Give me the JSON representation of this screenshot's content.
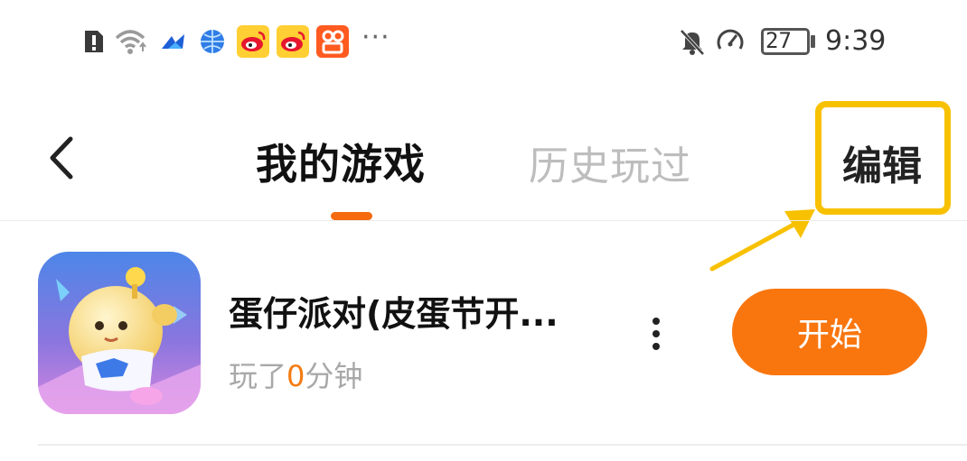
{
  "status_bar": {
    "time": "9:39",
    "battery_level": "27",
    "more_indicator": "···",
    "icons": [
      "alert-icon",
      "wifi-icon",
      "app-arrow-icon",
      "globe-icon",
      "weibo-icon",
      "weibo-icon",
      "video-app-icon",
      "mute-icon",
      "speed-icon",
      "battery-icon"
    ]
  },
  "header": {
    "tabs": [
      {
        "label": "我的游戏",
        "active": true
      },
      {
        "label": "历史玩过",
        "active": false
      }
    ],
    "edit_label": "编辑",
    "accent_color": "#f56b0e",
    "highlight_color": "#f8c100"
  },
  "games": [
    {
      "name": "蛋仔派对(皮蛋节开...",
      "played_prefix": "玩了",
      "played_minutes": "0",
      "played_suffix": "分钟",
      "start_label": "开始"
    }
  ]
}
